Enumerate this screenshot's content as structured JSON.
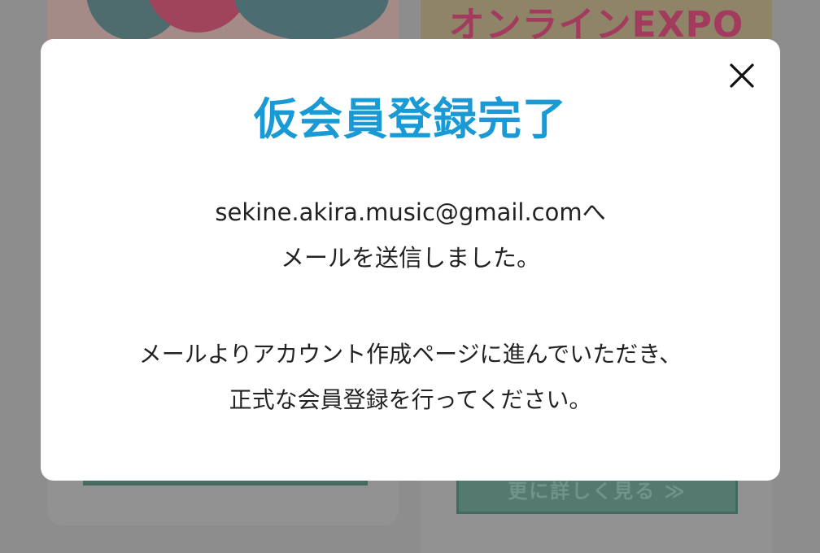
{
  "background": {
    "expo_banner_text": "オンラインEXPO",
    "details_button_label": "更に詳しく見る ≫"
  },
  "modal": {
    "title": "仮会員登録完了",
    "email_line": "sekine.akira.music@gmail.comへ",
    "sent_line": "メールを送信しました。",
    "instruction_line1": "メールよりアカウント作成ページに進んでいただき、",
    "instruction_line2": "正式な会員登録を行ってください。",
    "close_icon": "close-icon"
  },
  "colors": {
    "title": "#1a9ad4",
    "overlay": "#8d8d8d",
    "modal_bg": "#ffffff",
    "text": "#222222"
  }
}
